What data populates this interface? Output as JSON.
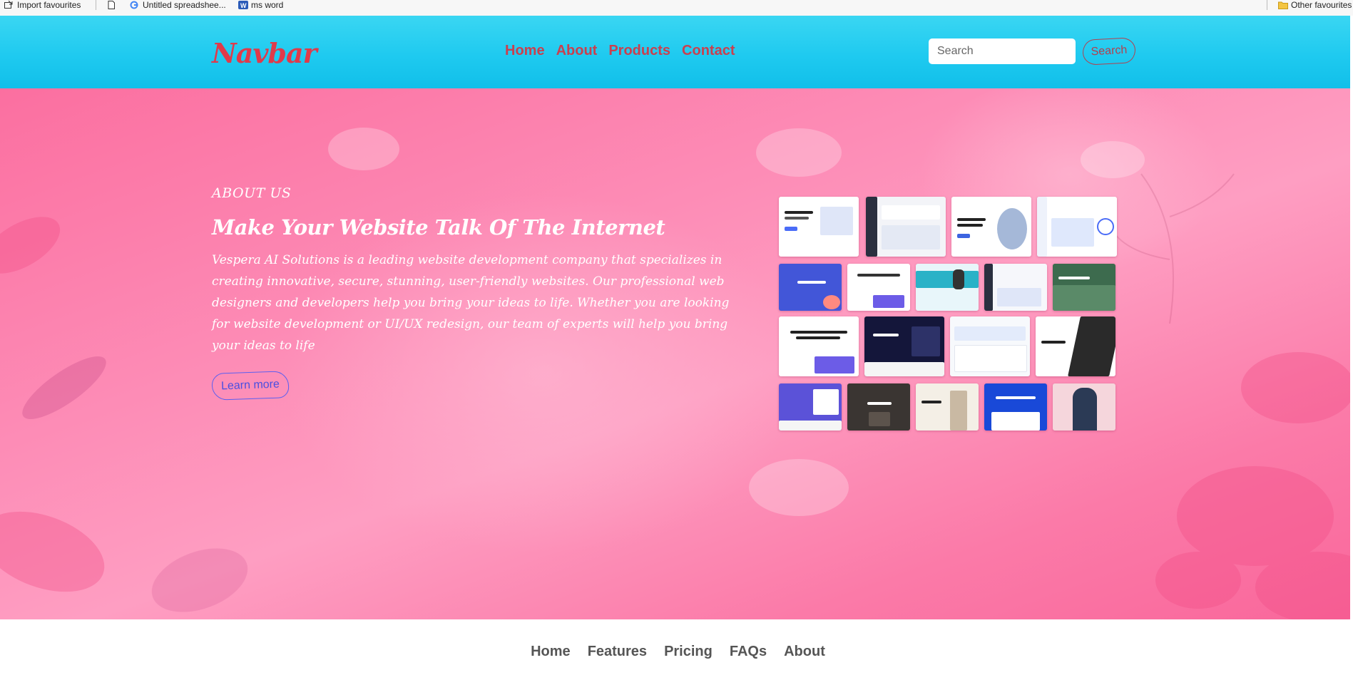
{
  "bookmarks": {
    "items": [
      {
        "label": "Import favourites",
        "icon": "import-icon"
      },
      {
        "label": "",
        "icon": "page-icon"
      },
      {
        "label": "Untitled spreadshee...",
        "icon": "google-icon"
      },
      {
        "label": "ms word",
        "icon": "word-icon"
      }
    ],
    "other": {
      "label": "Other favourites",
      "icon": "folder-icon"
    }
  },
  "navbar": {
    "brand": "Navbar",
    "links": [
      "Home",
      "About",
      "Products",
      "Contact"
    ],
    "search_placeholder": "Search",
    "search_button": "Search",
    "colors": {
      "bar": "#1fcaf0",
      "links": "#c9404f",
      "brand": "#e03a4a"
    }
  },
  "hero": {
    "eyebrow": "ABOUT US",
    "headline": "Make Your Website Talk Of The Internet",
    "description": "Vespera AI Solutions is a leading website development company that specializes in creating innovative, secure, stunning, user-friendly websites. Our professional web designers and developers help you bring your ideas to life. Whether you are looking for website development or UI/UX redesign, our team of experts will help you bring your ideas to life",
    "cta": "Learn more",
    "collage": {
      "thumb_texts": [
        "Welcome to Landkit Develop anything",
        "Turn your ideas into a startup",
        "Launch on time, look on trend.",
        "A modern design system for your new SaaS platform.",
        "Stay like a local",
        "A modern design system for your new SaaS platform .",
        "A better way",
        "look like an expert right from the start",
        "Truckle",
        "Blouses & Tops"
      ]
    },
    "colors": {
      "background": "#fd8cb6",
      "text": "#ffffff",
      "cta": "#4b4fe0"
    }
  },
  "footer": {
    "links": [
      "Home",
      "Features",
      "Pricing",
      "FAQs",
      "About"
    ]
  }
}
